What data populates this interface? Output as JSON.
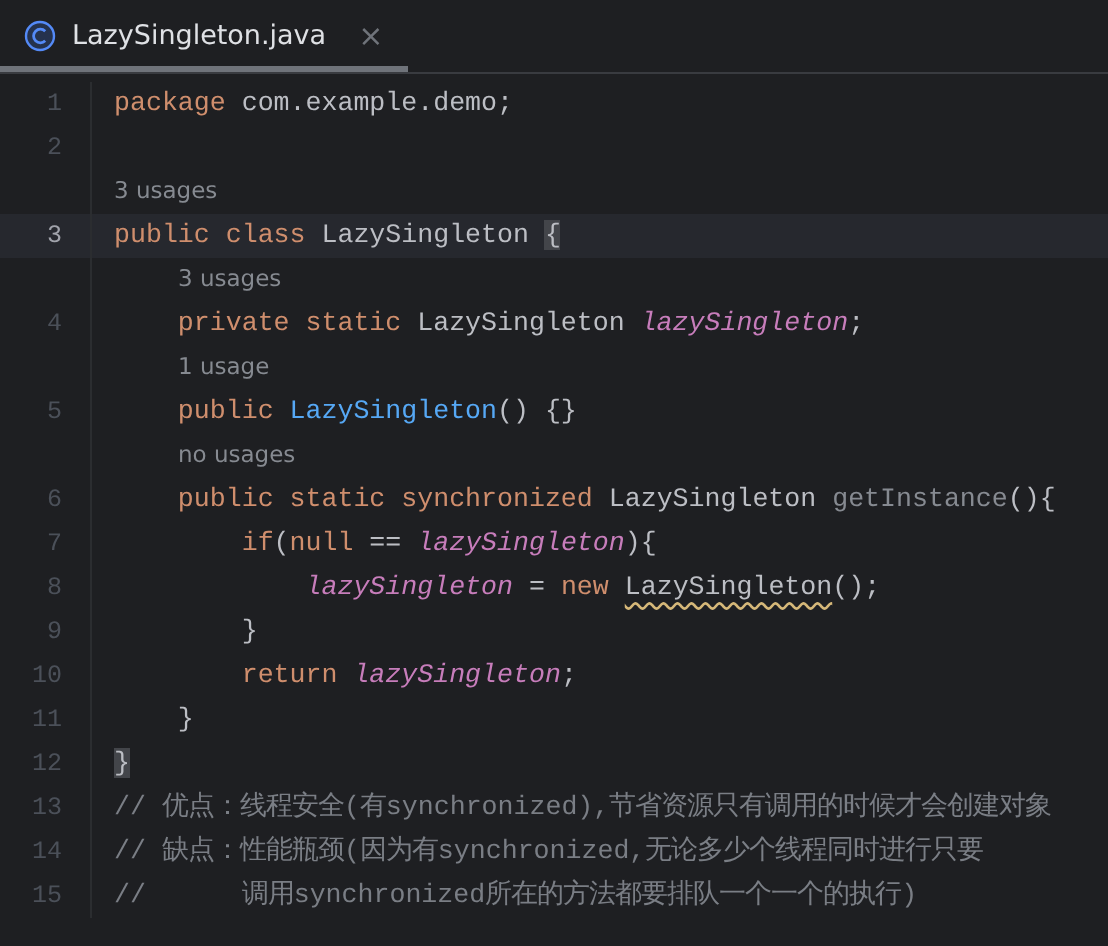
{
  "tab": {
    "title": "LazySingleton.java",
    "close": "×",
    "selected": true
  },
  "rows": [
    {
      "kind": "code",
      "number": "1",
      "current": false,
      "tokens": [
        {
          "kind": "keyword",
          "text": "package"
        },
        {
          "kind": "plain",
          "text": " com.example.demo;"
        }
      ]
    },
    {
      "kind": "code",
      "number": "2",
      "current": false,
      "tokens": []
    },
    {
      "kind": "hint",
      "text": "3 usages"
    },
    {
      "kind": "code",
      "number": "3",
      "current": true,
      "tokens": [
        {
          "kind": "keyword",
          "text": "public class "
        },
        {
          "kind": "plain",
          "text": "LazySingleton "
        },
        {
          "kind": "brace-match",
          "text": "{"
        }
      ]
    },
    {
      "kind": "hint",
      "indent": true,
      "text": "3 usages"
    },
    {
      "kind": "code",
      "number": "4",
      "current": false,
      "tokens": [
        {
          "kind": "keyword",
          "text": "    private static "
        },
        {
          "kind": "plain",
          "text": "LazySingleton "
        },
        {
          "kind": "field",
          "text": "lazySingleton"
        },
        {
          "kind": "plain",
          "text": ";"
        }
      ]
    },
    {
      "kind": "hint",
      "indent": true,
      "text": "1 usage"
    },
    {
      "kind": "code",
      "number": "5",
      "current": false,
      "tokens": [
        {
          "kind": "keyword",
          "text": "    public "
        },
        {
          "kind": "method",
          "text": "LazySingleton"
        },
        {
          "kind": "plain",
          "text": "() {}"
        }
      ]
    },
    {
      "kind": "hint",
      "indent": true,
      "text": "no usages"
    },
    {
      "kind": "code",
      "number": "6",
      "current": false,
      "tokens": [
        {
          "kind": "keyword",
          "text": "    public static synchronized "
        },
        {
          "kind": "plain",
          "text": "LazySingleton "
        },
        {
          "kind": "unused",
          "text": "getInstance"
        },
        {
          "kind": "plain",
          "text": "(){"
        }
      ]
    },
    {
      "kind": "code",
      "number": "7",
      "current": false,
      "tokens": [
        {
          "kind": "keyword",
          "text": "        if"
        },
        {
          "kind": "plain",
          "text": "("
        },
        {
          "kind": "keyword",
          "text": "null"
        },
        {
          "kind": "plain",
          "text": " == "
        },
        {
          "kind": "field",
          "text": "lazySingleton"
        },
        {
          "kind": "plain",
          "text": "){"
        }
      ]
    },
    {
      "kind": "code",
      "number": "8",
      "current": false,
      "tokens": [
        {
          "kind": "field",
          "text": "            lazySingleton"
        },
        {
          "kind": "plain",
          "text": " = "
        },
        {
          "kind": "keyword",
          "text": "new "
        },
        {
          "kind": "warning",
          "text": "LazySingleton"
        },
        {
          "kind": "plain",
          "text": "();"
        }
      ]
    },
    {
      "kind": "code",
      "number": "9",
      "current": false,
      "tokens": [
        {
          "kind": "plain",
          "text": "        }"
        }
      ]
    },
    {
      "kind": "code",
      "number": "10",
      "current": false,
      "tokens": [
        {
          "kind": "keyword",
          "text": "        return "
        },
        {
          "kind": "field",
          "text": "lazySingleton"
        },
        {
          "kind": "plain",
          "text": ";"
        }
      ]
    },
    {
      "kind": "code",
      "number": "11",
      "current": false,
      "tokens": [
        {
          "kind": "plain",
          "text": "    }"
        }
      ]
    },
    {
      "kind": "code",
      "number": "12",
      "current": false,
      "tokens": [
        {
          "kind": "brace-match",
          "text": "}"
        }
      ]
    },
    {
      "kind": "code",
      "number": "13",
      "current": false,
      "tokens": [
        {
          "kind": "comment",
          "text": "// 优点：线程安全(有synchronized),节省资源只有调用的时候才会创建对象"
        }
      ]
    },
    {
      "kind": "code",
      "number": "14",
      "current": false,
      "tokens": [
        {
          "kind": "comment",
          "text": "// 缺点：性能瓶颈(因为有synchronized,无论多少个线程同时进行只要"
        }
      ]
    },
    {
      "kind": "code",
      "number": "15",
      "current": false,
      "tokens": [
        {
          "kind": "comment",
          "text": "//      调用synchronized所在的方法都要排队一个一个的执行)"
        }
      ]
    }
  ]
}
